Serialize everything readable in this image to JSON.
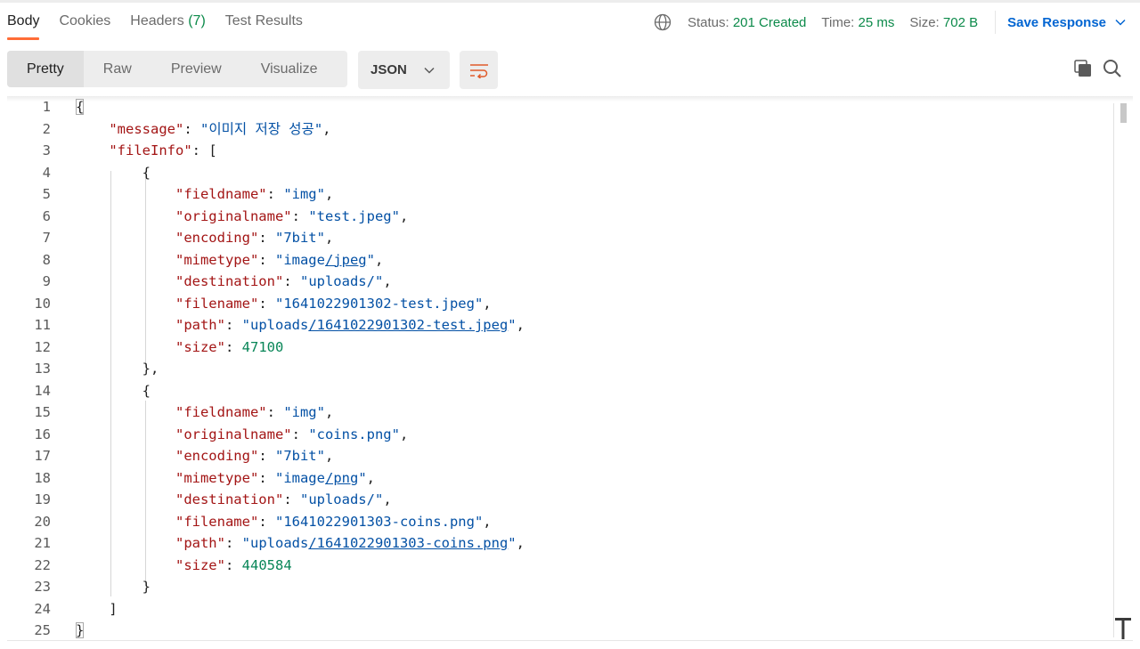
{
  "tabs": [
    {
      "label": "Body"
    },
    {
      "label": "Cookies"
    },
    {
      "label": "Headers",
      "count": "(7)"
    },
    {
      "label": "Test Results"
    }
  ],
  "status": {
    "status_label": "Status:",
    "status_value": "201 Created",
    "time_label": "Time:",
    "time_value": "25 ms",
    "size_label": "Size:",
    "size_value": "702 B",
    "save_label": "Save Response"
  },
  "view_modes": [
    "Pretty",
    "Raw",
    "Preview",
    "Visualize"
  ],
  "format": "JSON",
  "colors": {
    "accent": "#ff6c37",
    "ok": "#0c8a4a",
    "link": "#0265d2",
    "key": "#a31515",
    "string": "#0451a5",
    "number": "#098658"
  },
  "icons": [
    "globe-icon",
    "chevron-down-icon",
    "wrap-lines-icon",
    "copy-icon",
    "search-icon"
  ],
  "response": {
    "message": "이미지 저장 성공",
    "fileInfo": [
      {
        "fieldname": "img",
        "originalname": "test.jpeg",
        "encoding": "7bit",
        "mimetype": "image/jpeg",
        "destination": "uploads/",
        "filename": "1641022901302-test.jpeg",
        "path": "uploads/1641022901302-test.jpeg",
        "size": 47100
      },
      {
        "fieldname": "img",
        "originalname": "coins.png",
        "encoding": "7bit",
        "mimetype": "image/png",
        "destination": "uploads/",
        "filename": "1641022901303-coins.png",
        "path": "uploads/1641022901303-coins.png",
        "size": 440584
      }
    ]
  }
}
